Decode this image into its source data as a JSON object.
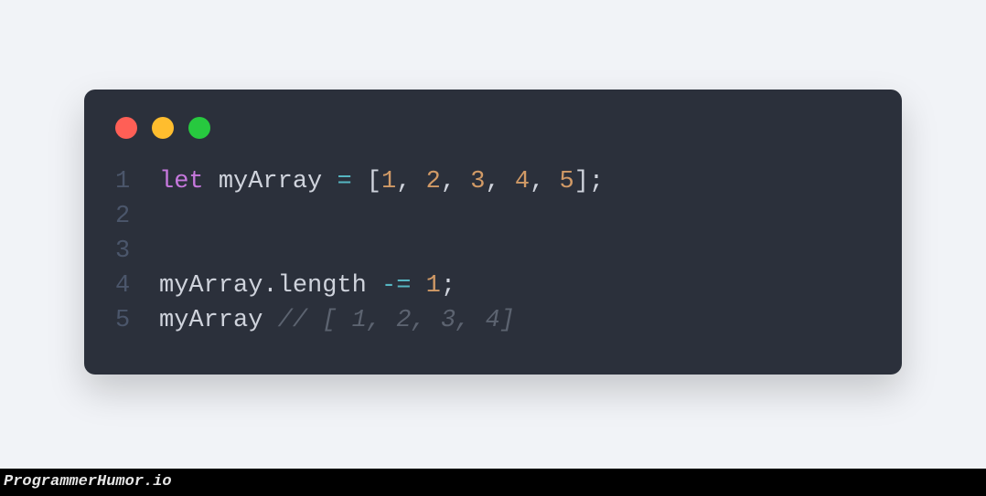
{
  "window": {
    "dots": [
      "red",
      "yellow",
      "green"
    ]
  },
  "code": {
    "lines": [
      {
        "n": "1",
        "tokens": [
          {
            "t": "let",
            "c": "kw"
          },
          {
            "t": " ",
            "c": "txt"
          },
          {
            "t": "myArray",
            "c": "ident"
          },
          {
            "t": " ",
            "c": "txt"
          },
          {
            "t": "=",
            "c": "op"
          },
          {
            "t": " ",
            "c": "txt"
          },
          {
            "t": "[",
            "c": "punct"
          },
          {
            "t": "1",
            "c": "num"
          },
          {
            "t": ", ",
            "c": "punct"
          },
          {
            "t": "2",
            "c": "num"
          },
          {
            "t": ", ",
            "c": "punct"
          },
          {
            "t": "3",
            "c": "num"
          },
          {
            "t": ", ",
            "c": "punct"
          },
          {
            "t": "4",
            "c": "num"
          },
          {
            "t": ", ",
            "c": "punct"
          },
          {
            "t": "5",
            "c": "num"
          },
          {
            "t": "];",
            "c": "punct"
          }
        ]
      },
      {
        "n": "2",
        "tokens": []
      },
      {
        "n": "3",
        "tokens": []
      },
      {
        "n": "4",
        "tokens": [
          {
            "t": "myArray",
            "c": "ident"
          },
          {
            "t": ".",
            "c": "punct"
          },
          {
            "t": "length",
            "c": "ident"
          },
          {
            "t": " ",
            "c": "txt"
          },
          {
            "t": "-=",
            "c": "op"
          },
          {
            "t": " ",
            "c": "txt"
          },
          {
            "t": "1",
            "c": "num"
          },
          {
            "t": ";",
            "c": "punct"
          }
        ]
      },
      {
        "n": "5",
        "tokens": [
          {
            "t": "myArray",
            "c": "ident"
          },
          {
            "t": " ",
            "c": "txt"
          },
          {
            "t": "// [ 1, 2, 3, 4]",
            "c": "comment"
          }
        ]
      }
    ]
  },
  "footer": {
    "text": "ProgrammerHumor.io"
  }
}
